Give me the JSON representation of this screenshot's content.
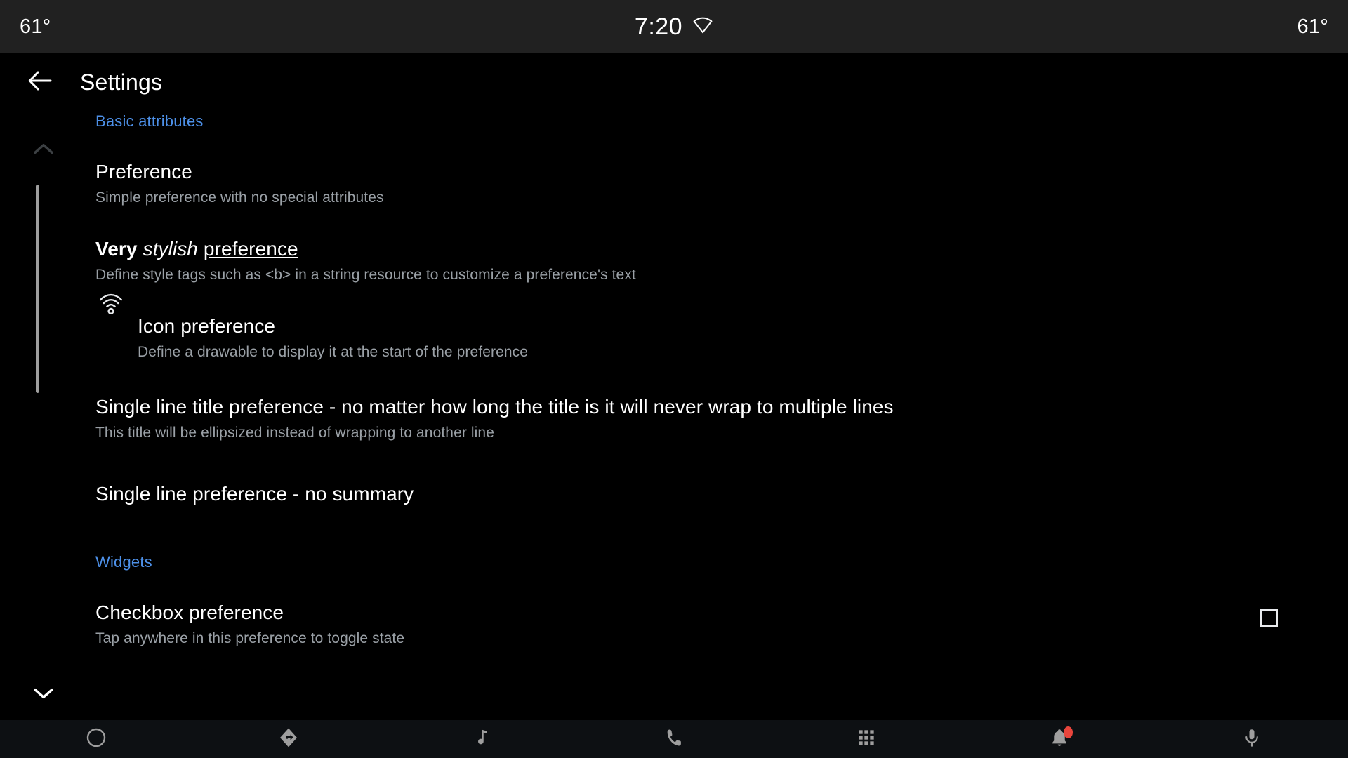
{
  "colors": {
    "status_bar_bg": "#212121",
    "body_bg": "#000000",
    "bottom_nav_bg": "#0d1013",
    "section_accent": "#4d90e8",
    "title_text": "#ffffff",
    "summary_text": "#9aa0a6",
    "scrollbar": "#9e9e9e",
    "nav_icon": "#9e9e9e",
    "badge": "#e8453c"
  },
  "status_bar": {
    "temp_left": "61°",
    "clock": "7:20",
    "temp_right": "61°",
    "signal_icon": "wifi-icon"
  },
  "app_bar": {
    "back_icon": "arrow-back-icon",
    "title": "Settings"
  },
  "content": {
    "scroll_up_icon": "chevron-up-icon",
    "scroll_down_icon": "chevron-down-icon",
    "sections": [
      {
        "header": "Basic attributes",
        "items": [
          {
            "title": "Preference",
            "summary": "Simple preference with no special attributes"
          },
          {
            "title_parts": {
              "bold": "Very",
              "italic": "stylish",
              "underline": "preference"
            },
            "summary": "Define style tags such as <b> in a string resource to customize a preference's text"
          },
          {
            "icon": "wifi-tethering-icon",
            "title": "Icon preference",
            "summary": "Define a drawable to display it at the start of the preference"
          },
          {
            "title": "Single line title preference - no matter how long the title is it will never wrap to multiple lines",
            "summary": "This title will be ellipsized instead of wrapping to another line"
          },
          {
            "title": "Single line preference - no summary",
            "summary": ""
          }
        ]
      },
      {
        "header": "Widgets",
        "items": [
          {
            "title": "Checkbox preference",
            "summary": "Tap anywhere in this preference to toggle state",
            "widget": "checkbox",
            "checked": false
          }
        ]
      }
    ]
  },
  "bottom_nav": {
    "items": [
      {
        "icon": "home-circle-icon",
        "badge": false
      },
      {
        "icon": "navigation-icon",
        "badge": false
      },
      {
        "icon": "music-note-icon",
        "badge": false
      },
      {
        "icon": "phone-icon",
        "badge": false
      },
      {
        "icon": "apps-grid-icon",
        "badge": false
      },
      {
        "icon": "notifications-bell-icon",
        "badge": true
      },
      {
        "icon": "microphone-icon",
        "badge": false
      }
    ]
  }
}
